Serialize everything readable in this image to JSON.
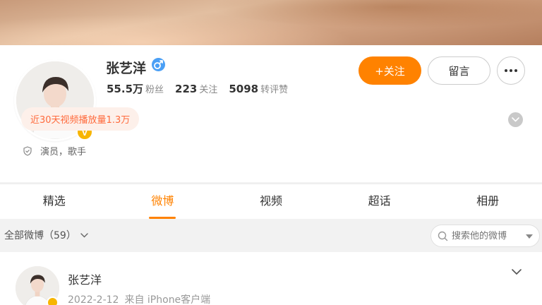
{
  "profile": {
    "name": "张艺洋",
    "verified_badge": "V",
    "gender": "male",
    "stats": [
      {
        "value": "55.5万",
        "label": "粉丝"
      },
      {
        "value": "223",
        "label": "关注"
      },
      {
        "value": "5098",
        "label": "转评赞"
      }
    ],
    "follow_label": "+关注",
    "message_label": "留言",
    "more_icon": "more-icon",
    "views_text": "近30天视频播放量1.3万",
    "tagline": "演员，歌手"
  },
  "tabs": [
    {
      "label": "精选",
      "active": false
    },
    {
      "label": "微博",
      "active": true
    },
    {
      "label": "视频",
      "active": false
    },
    {
      "label": "超话",
      "active": false
    },
    {
      "label": "相册",
      "active": false
    }
  ],
  "filter": {
    "label": "全部微博（59）",
    "search_placeholder": "搜索他的微博"
  },
  "post": {
    "author": "张艺洋",
    "date": "2022-2-12",
    "source": "来自 iPhone客户端"
  },
  "colors": {
    "accent": "#ff8200",
    "verified": "#f7b500",
    "male": "#4a9ff5"
  }
}
